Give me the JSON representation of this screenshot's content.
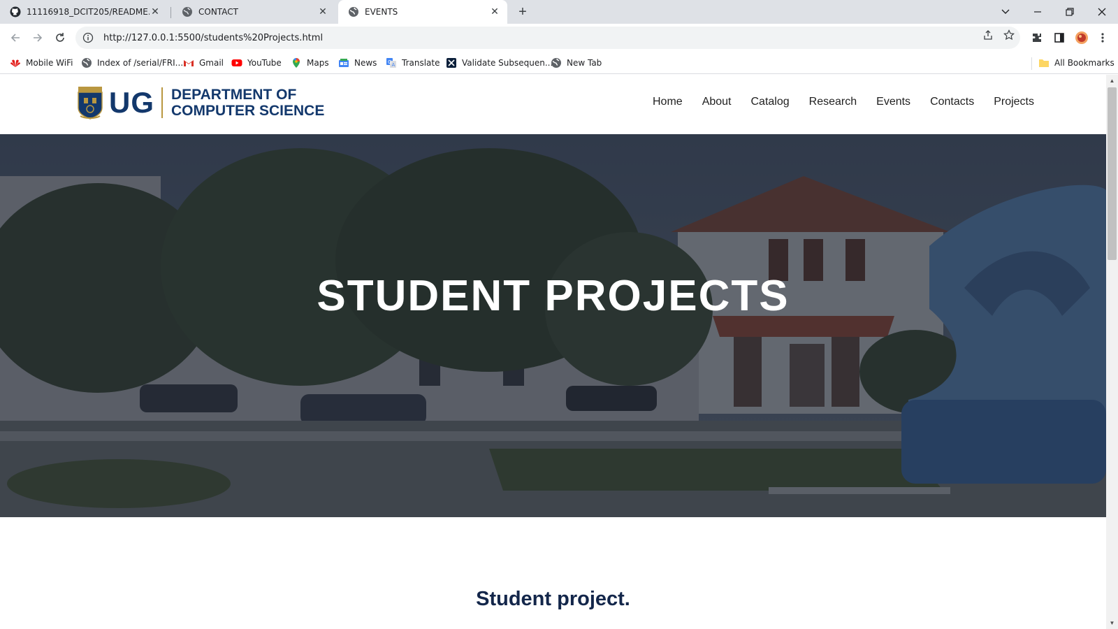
{
  "browser": {
    "tabs": [
      {
        "title": "11116918_DCIT205/README.md",
        "icon": "github-icon"
      },
      {
        "title": "CONTACT",
        "icon": "globe-icon"
      },
      {
        "title": "EVENTS",
        "icon": "globe-icon",
        "active": true
      }
    ],
    "url": "http://127.0.0.1:5500/students%20Projects.html",
    "bookmarks": [
      {
        "label": "Mobile WiFi",
        "icon": "huawei-icon"
      },
      {
        "label": "Index of /serial/FRI...",
        "icon": "globe-icon"
      },
      {
        "label": "Gmail",
        "icon": "gmail-icon"
      },
      {
        "label": "YouTube",
        "icon": "youtube-icon"
      },
      {
        "label": "Maps",
        "icon": "maps-icon"
      },
      {
        "label": "News",
        "icon": "news-icon"
      },
      {
        "label": "Translate",
        "icon": "translate-icon"
      },
      {
        "label": "Validate Subsequen...",
        "icon": "bookmark-app-icon"
      },
      {
        "label": "New Tab",
        "icon": "globe-icon"
      }
    ],
    "all_bookmarks_label": "All Bookmarks"
  },
  "site": {
    "logo": {
      "short": "UG",
      "line1": "DEPARTMENT OF",
      "line2": "COMPUTER SCIENCE"
    },
    "nav": [
      "Home",
      "About",
      "Catalog",
      "Research",
      "Events",
      "Contacts",
      "Projects"
    ],
    "hero_title": "STUDENT PROJECTS",
    "section_title": "Student project."
  },
  "colors": {
    "brand_navy": "#13386c",
    "brand_gold": "#b99740",
    "hero_overlay": "#2b3340"
  }
}
